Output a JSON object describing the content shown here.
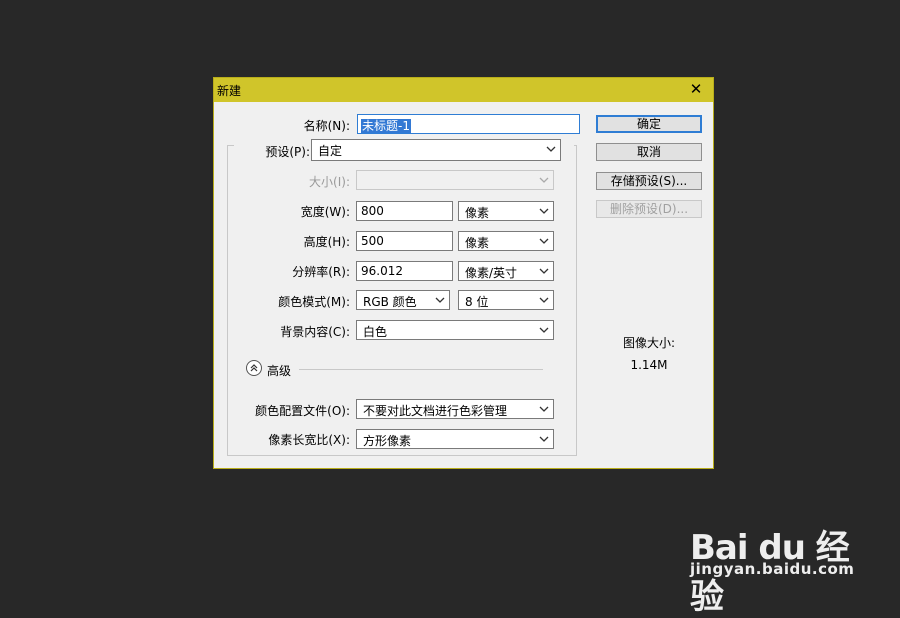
{
  "dialog": {
    "title": "新建",
    "close_glyph": "✕"
  },
  "form": {
    "name_label": "名称(N):",
    "name_value": "未标题-1",
    "preset_label": "预设(P):",
    "preset_value": "自定",
    "size_label": "大小(I):",
    "size_value": "",
    "width_label": "宽度(W):",
    "width_value": "800",
    "width_unit": "像素",
    "height_label": "高度(H):",
    "height_value": "500",
    "height_unit": "像素",
    "resolution_label": "分辨率(R):",
    "resolution_value": "96.012",
    "resolution_unit": "像素/英寸",
    "color_mode_label": "颜色模式(M):",
    "color_mode_value": "RGB 颜色",
    "bit_depth_value": "8 位",
    "background_label": "背景内容(C):",
    "background_value": "白色",
    "advanced_label": "高级",
    "color_profile_label": "颜色配置文件(O):",
    "color_profile_value": "不要对此文档进行色彩管理",
    "pixel_aspect_label": "像素长宽比(X):",
    "pixel_aspect_value": "方形像素"
  },
  "buttons": {
    "ok": "确定",
    "cancel": "取消",
    "save_preset": "存储预设(S)...",
    "delete_preset": "删除预设(D)..."
  },
  "image_size": {
    "label": "图像大小:",
    "value": "1.14M"
  },
  "watermark": {
    "logo": "Bai du 经验",
    "url": "jingyan.baidu.com"
  },
  "colors": {
    "titlebar": "#d0c52a",
    "background": "#282828",
    "accent": "#2f7dd4"
  }
}
